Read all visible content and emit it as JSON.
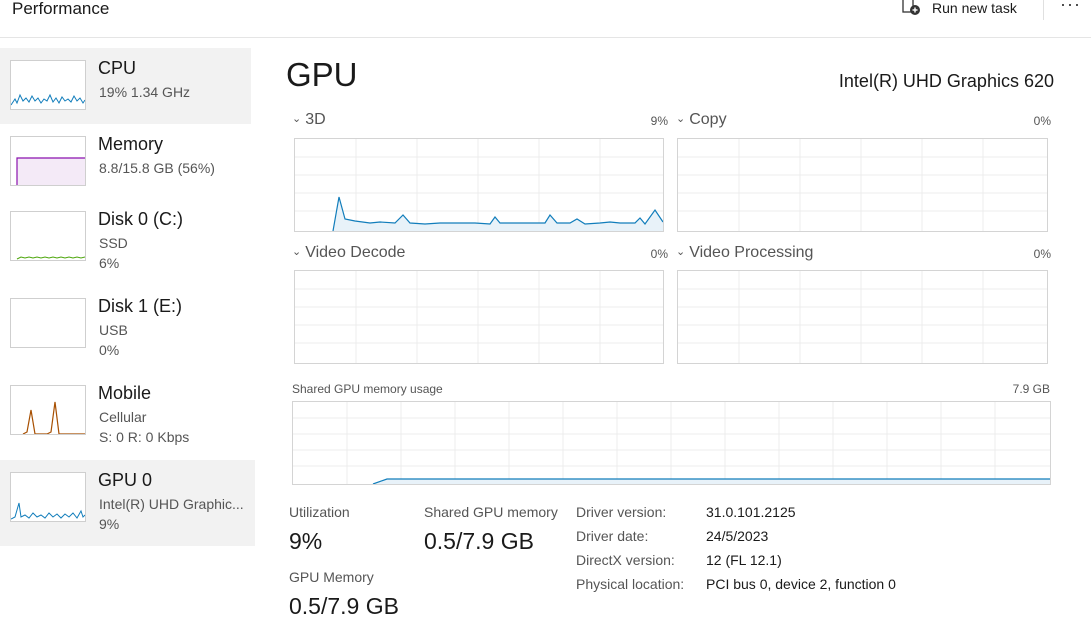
{
  "app": {
    "title": "Performance",
    "run_new_task_label": "Run new task",
    "run_new_task_icon": "new-task-icon",
    "more_icon": "more-options-icon",
    "more_glyph": "···"
  },
  "sidebar": {
    "items": [
      {
        "name": "CPU",
        "sub1": "19% 1.34 GHz",
        "sub2": "",
        "color": "#117dbb",
        "selected": true
      },
      {
        "name": "Memory",
        "sub1": "8.8/15.8 GB (56%)",
        "sub2": "",
        "color": "#8b12ae",
        "selected": false
      },
      {
        "name": "Disk 0 (C:)",
        "sub1": "SSD",
        "sub2": "6%",
        "color": "#4da60c",
        "selected": false
      },
      {
        "name": "Disk 1 (E:)",
        "sub1": "USB",
        "sub2": "0%",
        "color": "#4da60c",
        "selected": false
      },
      {
        "name": "Mobile",
        "sub1": "Cellular",
        "sub2": "S: 0 R: 0 Kbps",
        "color": "#a74f01",
        "selected": false
      },
      {
        "name": "GPU 0",
        "sub1": "Intel(R) UHD Graphic...",
        "sub2": "9%",
        "color": "#117dbb",
        "selected": true
      }
    ]
  },
  "gpu": {
    "title": "GPU",
    "model": "Intel(R) UHD Graphics 620",
    "accent_color": "#117dbb",
    "engines": [
      {
        "label": "3D",
        "percent": "9%"
      },
      {
        "label": "Copy",
        "percent": "0%"
      },
      {
        "label": "Video Decode",
        "percent": "0%"
      },
      {
        "label": "Video Processing",
        "percent": "0%"
      }
    ],
    "shared_memory_graph": {
      "label": "Shared GPU memory usage",
      "max": "7.9 GB"
    },
    "stats": {
      "utilization_label": "Utilization",
      "utilization_value": "9%",
      "shared_mem_label": "Shared GPU memory",
      "shared_mem_value": "0.5/7.9 GB",
      "gpu_mem_label": "GPU Memory",
      "gpu_mem_value": "0.5/7.9 GB"
    },
    "info": [
      {
        "key": "Driver version:",
        "value": "31.0.101.2125"
      },
      {
        "key": "Driver date:",
        "value": "24/5/2023"
      },
      {
        "key": "DirectX version:",
        "value": "12 (FL 12.1)"
      },
      {
        "key": "Physical location:",
        "value": "PCI bus 0, device 2, function 0"
      }
    ]
  }
}
